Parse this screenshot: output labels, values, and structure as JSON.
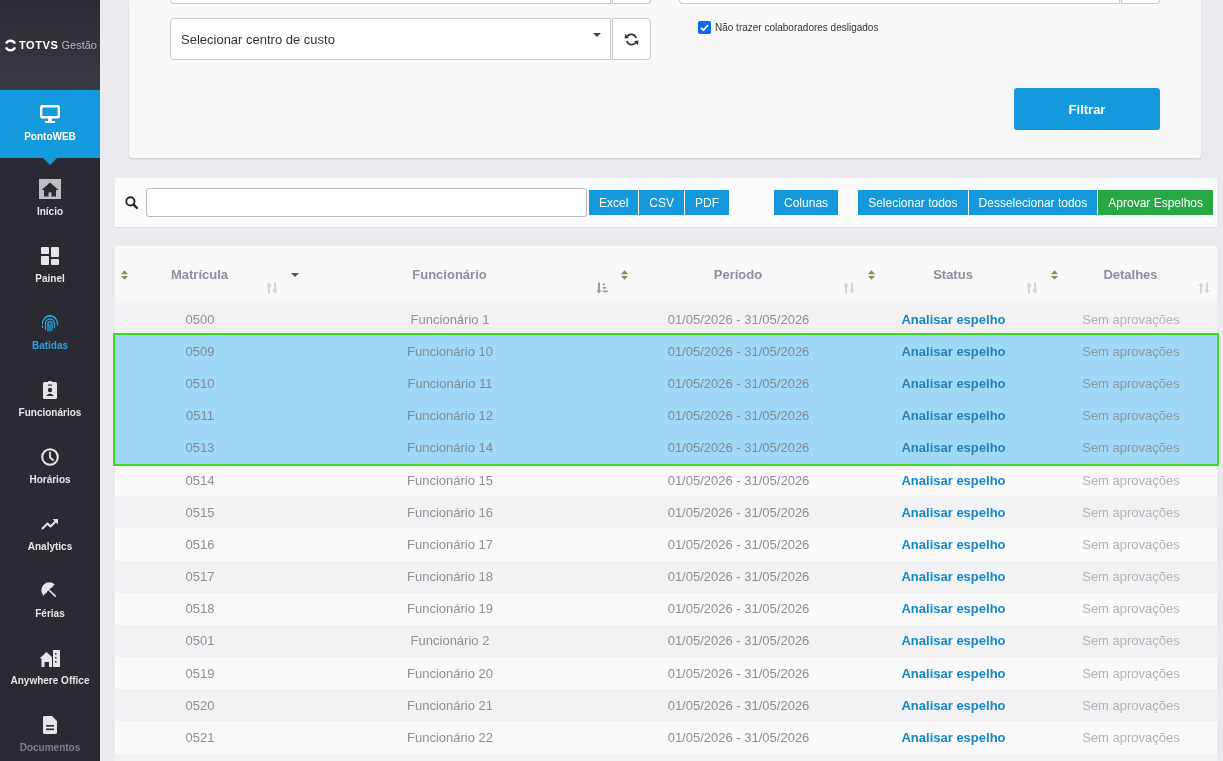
{
  "sidebar": {
    "logo": {
      "brand": "TOTVS",
      "product": "Gestão"
    },
    "module": {
      "label": "PontoWEB",
      "selected": true
    },
    "items": [
      {
        "label": "Início",
        "selected": false,
        "disabled": false
      },
      {
        "label": "Painel",
        "selected": false,
        "disabled": false
      },
      {
        "label": "Batidas",
        "selected": true,
        "disabled": false
      },
      {
        "label": "Funcionários",
        "selected": false,
        "disabled": false
      },
      {
        "label": "Horários",
        "selected": false,
        "disabled": false
      },
      {
        "label": "Analytics",
        "selected": false,
        "disabled": false
      },
      {
        "label": "Férias",
        "selected": false,
        "disabled": false
      },
      {
        "label": "Anywhere Office",
        "selected": false,
        "disabled": false
      },
      {
        "label": "Documentos",
        "selected": false,
        "disabled": true
      }
    ]
  },
  "filters": {
    "cost_center": {
      "label": "Selecionar centro de custo"
    },
    "exclude_dismissed": {
      "label": "Não trazer colaboradores desligados",
      "checked": true
    },
    "submit": "Filtrar"
  },
  "toolbar": {
    "export_buttons": [
      "Excel",
      "CSV",
      "PDF"
    ],
    "columns_button": "Colunas",
    "selection_buttons": [
      "Selecionar todos",
      "Desselecionar todos"
    ],
    "approve_button": "Aprovar Espelhos"
  },
  "table": {
    "columns": [
      {
        "label": "Matrícula",
        "sorted": false
      },
      {
        "label": "Funcionário",
        "sorted": true
      },
      {
        "label": "Período",
        "sorted": false
      },
      {
        "label": "Status",
        "sorted": false
      },
      {
        "label": "Detalhes",
        "sorted": false
      }
    ],
    "rows": [
      {
        "registration": "0500",
        "employee": "Funcionário 1",
        "period": "01/05/2026 - 31/05/2026",
        "status": "Analisar espelho",
        "details": "Sem aprovações",
        "selected": false
      },
      {
        "registration": "0509",
        "employee": "Funcionário 10",
        "period": "01/05/2026 - 31/05/2026",
        "status": "Analisar espelho",
        "details": "Sem aprovações",
        "selected": true
      },
      {
        "registration": "0510",
        "employee": "Funcionário 11",
        "period": "01/05/2026 - 31/05/2026",
        "status": "Analisar espelho",
        "details": "Sem aprovações",
        "selected": true
      },
      {
        "registration": "0511",
        "employee": "Funcionário 12",
        "period": "01/05/2026 - 31/05/2026",
        "status": "Analisar espelho",
        "details": "Sem aprovações",
        "selected": true
      },
      {
        "registration": "0513",
        "employee": "Funcionário 14",
        "period": "01/05/2026 - 31/05/2026",
        "status": "Analisar espelho",
        "details": "Sem aprovações",
        "selected": true
      },
      {
        "registration": "0514",
        "employee": "Funcionário 15",
        "period": "01/05/2026 - 31/05/2026",
        "status": "Analisar espelho",
        "details": "Sem aprovações",
        "selected": false
      },
      {
        "registration": "0515",
        "employee": "Funcionário 16",
        "period": "01/05/2026 - 31/05/2026",
        "status": "Analisar espelho",
        "details": "Sem aprovações",
        "selected": false
      },
      {
        "registration": "0516",
        "employee": "Funcionário 17",
        "period": "01/05/2026 - 31/05/2026",
        "status": "Analisar espelho",
        "details": "Sem aprovações",
        "selected": false
      },
      {
        "registration": "0517",
        "employee": "Funcionário 18",
        "period": "01/05/2026 - 31/05/2026",
        "status": "Analisar espelho",
        "details": "Sem aprovações",
        "selected": false
      },
      {
        "registration": "0518",
        "employee": "Funcionário 19",
        "period": "01/05/2026 - 31/05/2026",
        "status": "Analisar espelho",
        "details": "Sem aprovações",
        "selected": false
      },
      {
        "registration": "0501",
        "employee": "Funcionário 2",
        "period": "01/05/2026 - 31/05/2026",
        "status": "Analisar espelho",
        "details": "Sem aprovações",
        "selected": false
      },
      {
        "registration": "0519",
        "employee": "Funcionário 20",
        "period": "01/05/2026 - 31/05/2026",
        "status": "Analisar espelho",
        "details": "Sem aprovações",
        "selected": false
      },
      {
        "registration": "0520",
        "employee": "Funcionário 21",
        "period": "01/05/2026 - 31/05/2026",
        "status": "Analisar espelho",
        "details": "Sem aprovações",
        "selected": false
      },
      {
        "registration": "0521",
        "employee": "Funcionário 22",
        "period": "01/05/2026 - 31/05/2026",
        "status": "Analisar espelho",
        "details": "Sem aprovações",
        "selected": false
      }
    ]
  }
}
